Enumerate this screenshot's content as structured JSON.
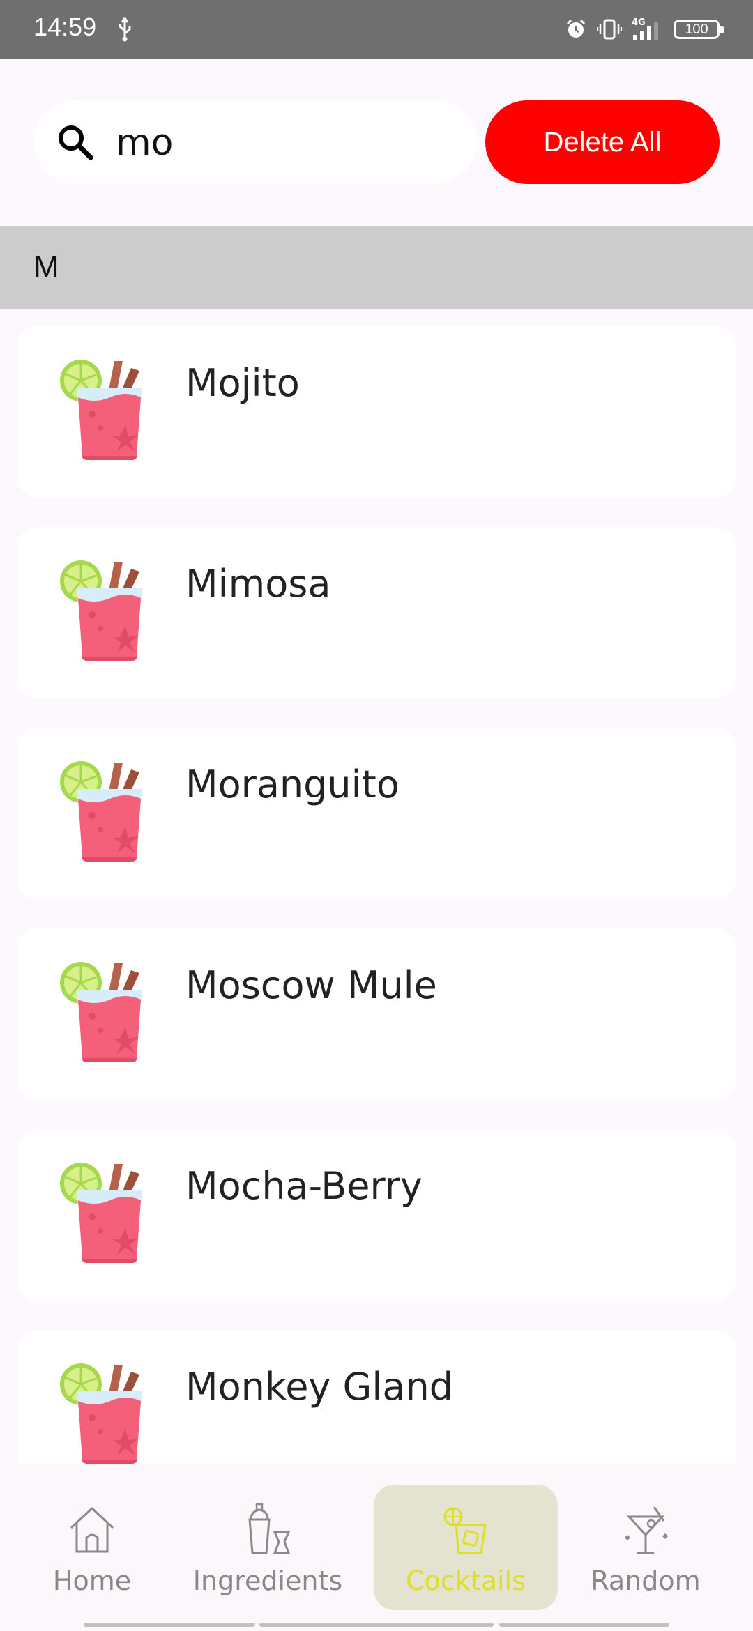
{
  "status_bar": {
    "time": "14:59",
    "network": "4G",
    "battery": "100"
  },
  "search": {
    "value": "mo"
  },
  "actions": {
    "delete_all_label": "Delete All",
    "delete_all_color": "#ff0000"
  },
  "section": {
    "letter": "M"
  },
  "cocktails": [
    {
      "name": "Mojito"
    },
    {
      "name": "Mimosa"
    },
    {
      "name": "Moranguito"
    },
    {
      "name": "Moscow Mule"
    },
    {
      "name": "Mocha-Berry"
    },
    {
      "name": "Monkey Gland"
    }
  ],
  "nav": {
    "home": "Home",
    "ingredients": "Ingredients",
    "cocktails": "Cocktails",
    "random": "Random",
    "active": "cocktails",
    "active_color": "#dede26"
  },
  "icons": {
    "search": "search-icon",
    "cocktail": "cocktail-glass-icon",
    "home": "home-icon",
    "ingredients": "shaker-icon",
    "cocktails": "cocktail-icon",
    "random": "martini-icon"
  }
}
